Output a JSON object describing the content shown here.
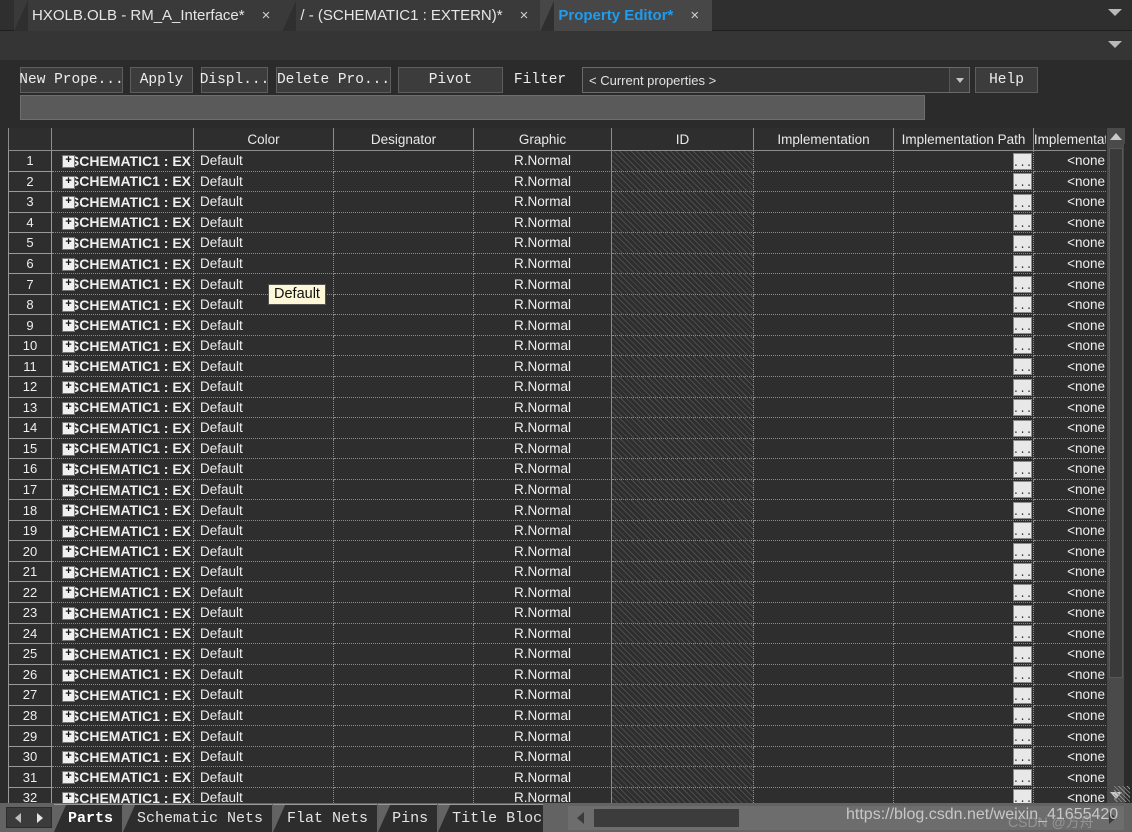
{
  "window": {
    "tabs": [
      {
        "label": "HXOLB.OLB - RM_A_Interface*",
        "close": "×",
        "active": false
      },
      {
        "label": "/ - (SCHEMATIC1 : EXTERN)*",
        "close": "×",
        "active": false
      },
      {
        "label": "Property Editor*",
        "close": "×",
        "active": true
      }
    ],
    "tabbar_overflow_icon": "chevron-down-icon",
    "subbar_overflow_icon": "chevron-down-icon"
  },
  "toolbar": {
    "new_property": "New Prope...",
    "apply": "Apply",
    "display": "Displ...",
    "delete_property": "Delete Pro...",
    "pivot": "Pivot",
    "filter": "Filter",
    "filter_value": "< Current properties >",
    "help": "Help"
  },
  "edit_field": {
    "value": "",
    "placeholder": ""
  },
  "grid": {
    "columns": [
      {
        "key": "num",
        "label": ""
      },
      {
        "key": "name",
        "label": ""
      },
      {
        "key": "color",
        "label": "Color"
      },
      {
        "key": "desig",
        "label": "Designator"
      },
      {
        "key": "graphic",
        "label": "Graphic"
      },
      {
        "key": "id",
        "label": "ID"
      },
      {
        "key": "impl",
        "label": "Implementation"
      },
      {
        "key": "implpath",
        "label": "Implementation Path"
      },
      {
        "key": "impltype",
        "label": "Implementat"
      }
    ],
    "row_values": {
      "expander": "+",
      "name": "SCHEMATIC1 : EX",
      "color": "Default",
      "designator": "",
      "graphic": "R.Normal",
      "id": "",
      "implementation": "",
      "implementation_path_button": "...",
      "implementation_type": "<none"
    },
    "row_numbers": [
      1,
      2,
      3,
      4,
      5,
      6,
      7,
      8,
      9,
      10,
      11,
      12,
      13,
      14,
      15,
      16,
      17,
      18,
      19,
      20,
      21,
      22,
      23,
      24,
      25,
      26,
      27,
      28,
      29,
      30,
      31,
      32
    ]
  },
  "tooltip": {
    "text": "Default"
  },
  "bottom": {
    "nav_prev_icon": "triangle-left-icon",
    "nav_next_icon": "triangle-right-icon",
    "tabs": [
      {
        "label": "Parts",
        "selected": true
      },
      {
        "label": "Schematic Nets",
        "selected": false
      },
      {
        "label": "Flat Nets",
        "selected": false
      },
      {
        "label": "Pins",
        "selected": false
      },
      {
        "label": "Title Bloc",
        "selected": false
      }
    ]
  },
  "watermark": {
    "url": "https://blog.csdn.net/weixin_41655420",
    "brand": "CSDN @方舟"
  }
}
